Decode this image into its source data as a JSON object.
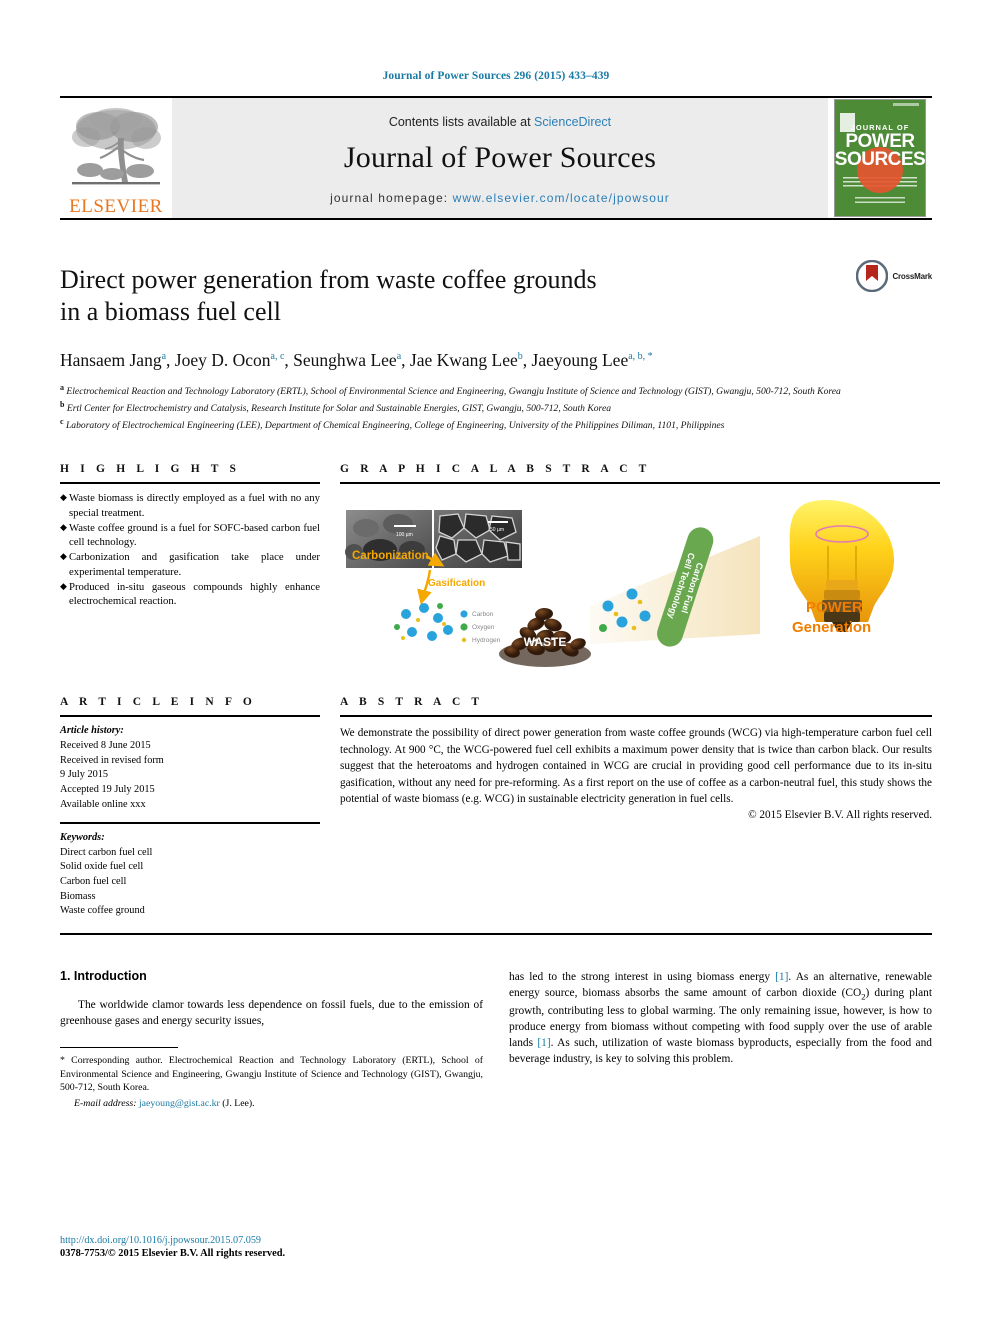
{
  "running_head": "Journal of Power Sources 296 (2015) 433–439",
  "masthead": {
    "publisher_name": "ELSEVIER",
    "contents_prefix": "Contents lists available at ",
    "contents_link": "ScienceDirect",
    "journal_name": "Journal of Power Sources",
    "homepage_prefix": "journal homepage: ",
    "homepage_url": "www.elsevier.com/locate/jpowsour",
    "cover": {
      "journal_of": "JOURNAL OF",
      "power": "POWER",
      "sources": "SOURCES"
    }
  },
  "article": {
    "title_line1": "Direct power generation from waste coffee grounds",
    "title_line2": "in a biomass fuel cell",
    "crossmark_label": "CrossMark",
    "authors": [
      {
        "name": "Hansaem Jang",
        "sup": "a"
      },
      {
        "name": "Joey D. Ocon",
        "sup": "a, c"
      },
      {
        "name": "Seunghwa Lee",
        "sup": "a"
      },
      {
        "name": "Jae Kwang Lee",
        "sup": "b"
      },
      {
        "name": "Jaeyoung Lee",
        "sup": "a, b, *"
      }
    ],
    "affiliations": [
      {
        "mark": "a",
        "text": "Electrochemical Reaction and Technology Laboratory (ERTL), School of Environmental Science and Engineering, Gwangju Institute of Science and Technology (GIST), Gwangju, 500-712, South Korea"
      },
      {
        "mark": "b",
        "text": "Ertl Center for Electrochemistry and Catalysis, Research Institute for Solar and Sustainable Energies, GIST, Gwangju, 500-712, South Korea"
      },
      {
        "mark": "c",
        "text": "Laboratory of Electrochemical Engineering (LEE), Department of Chemical Engineering, College of Engineering, University of the Philippines Diliman, 1101, Philippines"
      }
    ]
  },
  "highlights": {
    "heading": "H I G H L I G H T S",
    "items": [
      "Waste biomass is directly employed as a fuel with no any special treatment.",
      "Waste coffee ground is a fuel for SOFC-based carbon fuel cell technology.",
      "Carbonization and gasification take place under experimental temperature.",
      "Produced in-situ gaseous compounds highly enhance electrochemical reaction."
    ]
  },
  "graphical_abstract": {
    "heading": "G R A P H I C A L   A B S T R A C T",
    "labels": {
      "carbonization": "Carbonization",
      "gasification": "Gasification",
      "scalebar_left": "100 µm",
      "scalebar_right": "50 µm",
      "waste": "WASTE",
      "technology_banner": "Carbon Fuel Cell Technology",
      "power": "POWER",
      "generation": "Generation"
    },
    "legend": [
      {
        "label": "Carbon",
        "color": "#29a3dc"
      },
      {
        "label": "Oxygen",
        "color": "#3faa4a"
      },
      {
        "label": "Hydrogen",
        "color": "#e8c01c"
      }
    ]
  },
  "article_info": {
    "heading": "A R T I C L E   I N F O",
    "history_label": "Article history:",
    "history": [
      "Received 8 June 2015",
      "Received in revised form",
      "9 July 2015",
      "Accepted 19 July 2015",
      "Available online xxx"
    ],
    "keywords_label": "Keywords:",
    "keywords": [
      "Direct carbon fuel cell",
      "Solid oxide fuel cell",
      "Carbon fuel cell",
      "Biomass",
      "Waste coffee ground"
    ]
  },
  "abstract": {
    "heading": "A B S T R A C T",
    "text": "We demonstrate the possibility of direct power generation from waste coffee grounds (WCG) via high-temperature carbon fuel cell technology. At 900 °C, the WCG-powered fuel cell exhibits a maximum power density that is twice than carbon black. Our results suggest that the heteroatoms and hydrogen contained in WCG are crucial in providing good cell performance due to its in-situ gasification, without any need for pre-reforming. As a first report on the use of coffee as a carbon-neutral fuel, this study shows the potential of waste biomass (e.g. WCG) in sustainable electricity generation in fuel cells.",
    "copyright": "© 2015 Elsevier B.V. All rights reserved."
  },
  "body": {
    "section_number_title": "1. Introduction",
    "left_paragraph": "The worldwide clamor towards less dependence on fossil fuels, due to the emission of greenhouse gases and energy security issues,",
    "right_paragraph_a": "has led to the strong interest in using biomass energy ",
    "ref1": "[1]",
    "right_paragraph_b": ". As an alternative, renewable energy source, biomass absorbs the same amount of carbon dioxide (CO",
    "co2_sub": "2",
    "right_paragraph_c": ") during plant growth, contributing less to global warming. The only remaining issue, however, is how to produce energy from biomass without competing with food supply over the use of arable lands ",
    "ref2": "[1]",
    "right_paragraph_d": ". As such, utilization of waste biomass byproducts, especially from the food and beverage industry, is key to solving this problem."
  },
  "footnote": {
    "star": "*",
    "text": " Corresponding author. Electrochemical Reaction and Technology Laboratory (ERTL), School of Environmental Science and Engineering, Gwangju Institute of Science and Technology (GIST), Gwangju, 500-712, South Korea.",
    "email_label": "E-mail address:",
    "email": "jaeyoung@gist.ac.kr",
    "email_suffix": " (J. Lee)."
  },
  "footer": {
    "doi": "http://dx.doi.org/10.1016/j.jpowsour.2015.07.059",
    "issn": "0378-7753/© 2015 Elsevier B.V. All rights reserved."
  }
}
